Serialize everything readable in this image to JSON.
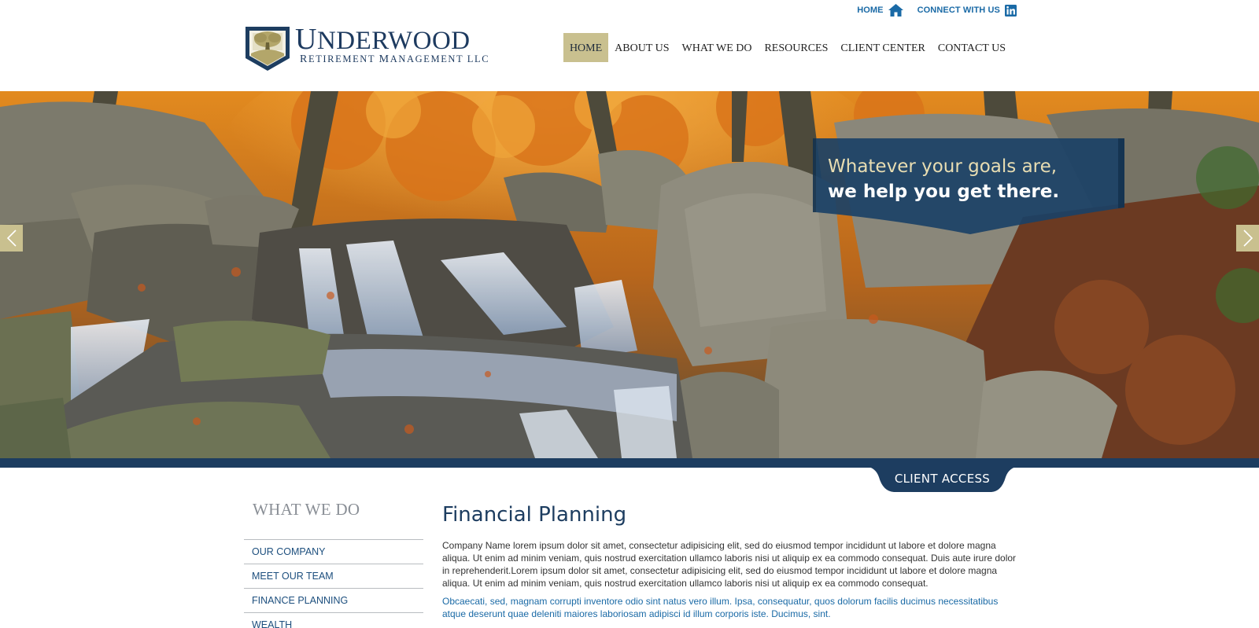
{
  "utility": {
    "home_label": "HOME",
    "connect_label": "CONNECT WITH US"
  },
  "logo": {
    "name_cap": "U",
    "name_rest": "NDERWOOD",
    "sub_cap1": "R",
    "sub_rest1": "ETIREMENT ",
    "sub_cap2": "M",
    "sub_rest2": "ANAGEMENT LLC"
  },
  "nav": {
    "items": [
      {
        "label": "HOME",
        "active": true
      },
      {
        "label": "ABOUT US"
      },
      {
        "label": "WHAT WE DO"
      },
      {
        "label": "RESOURCES"
      },
      {
        "label": "CLIENT CENTER"
      },
      {
        "label": "CONTACT US"
      }
    ]
  },
  "hero": {
    "tagline_line1": "Whatever your goals are,",
    "tagline_line2": "we help you get there.",
    "prev_icon": "chevron-left-icon",
    "next_icon": "chevron-right-icon"
  },
  "client_access": {
    "label": "CLIENT ACCESS"
  },
  "sidebar": {
    "title": "WHAT WE DO",
    "items": [
      "OUR COMPANY",
      "MEET OUR TEAM",
      "FINANCE PLANNING",
      "WEALTH"
    ]
  },
  "main": {
    "heading": "Financial Planning",
    "paragraph1": "Company Name lorem ipsum dolor sit amet, consectetur adipisicing elit, sed do eiusmod tempor incididunt ut labore et dolore magna aliqua. Ut enim ad minim veniam, quis nostrud exercitation ullamco laboris nisi ut aliquip ex ea commodo consequat. Duis aute irure dolor in reprehenderit.Lorem ipsum dolor sit amet, consectetur adipisicing elit, sed do eiusmod tempor incididunt ut labore et dolore magna aliqua. Ut enim ad minim veniam, quis nostrud exercitation ullamco laboris nisi ut aliquip ex ea commodo consequat.",
    "paragraph2": "Obcaecati, sed, magnam corrupti inventore odio sint natus vero illum. Ipsa, consequatur, quos dolorum facilis ducimus necessitatibus atque deserunt quae deleniti maiores laboriosam adipisci id illum corporis iste. Ducimus, sint."
  },
  "colors": {
    "brand_navy": "#1d3d60",
    "accent_tan": "#c9c08f",
    "link_blue": "#1a6aa6"
  }
}
